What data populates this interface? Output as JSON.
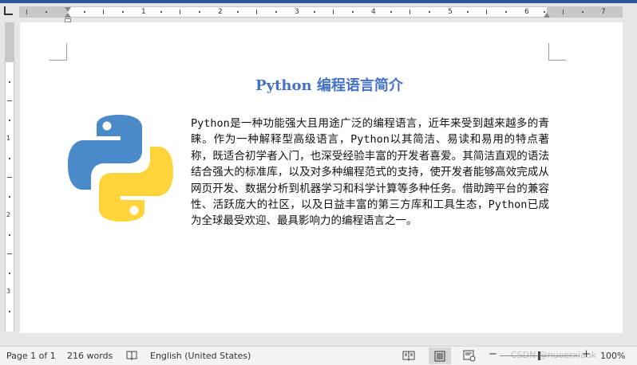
{
  "ruler": {
    "numbers": [
      "1",
      "2",
      "3",
      "4",
      "5",
      "6",
      "7"
    ],
    "vertical_numbers": [
      "1",
      "2",
      "3"
    ]
  },
  "document": {
    "title": "Python 编程语言简介",
    "body": "Python是一种功能强大且用途广泛的编程语言，近年来受到越来越多的青睐。作为一种解释型高级语言，Python以其简洁、易读和易用的特点著称，既适合初学者入门，也深受经验丰富的开发者喜爱。其简洁直观的语法结合强大的标准库，以及对多种编程范式的支持，使开发者能够高效完成从网页开发、数据分析到机器学习和科学计算等多种任务。借助跨平台的兼容性、活跃庞大的社区，以及日益丰富的第三方库和工具生态，Python已成为全球最受欢迎、最具影响力的编程语言之一。",
    "logo_icon": "python-logo-icon",
    "title_color": "#4472c4",
    "logo_colors": {
      "blue": "#4a8ac9",
      "yellow": "#ffd43b"
    }
  },
  "statusbar": {
    "page": "Page 1 of 1",
    "words": "216 words",
    "language": "English (United States)",
    "zoom": "100%",
    "zoom_minus": "−",
    "zoom_plus": "+",
    "watermark": "CSDN @nuoerxiaok"
  },
  "colors": {
    "accent": "#2b579a"
  }
}
